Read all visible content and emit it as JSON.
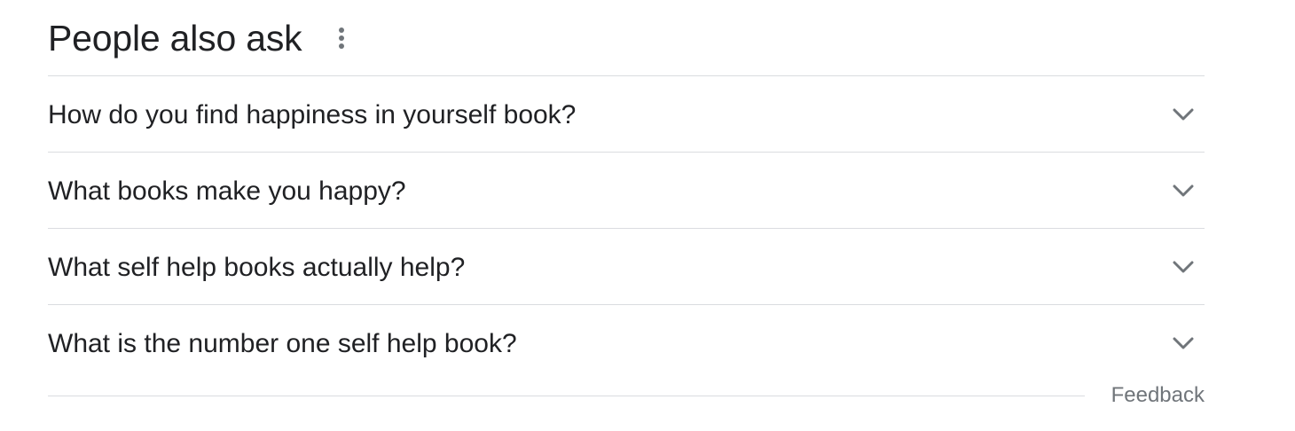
{
  "section": {
    "title": "People also ask",
    "more_icon": "more-vert-icon"
  },
  "questions": [
    {
      "text": "How do you find happiness in yourself book?",
      "icon": "chevron-down-icon"
    },
    {
      "text": "What books make you happy?",
      "icon": "chevron-down-icon"
    },
    {
      "text": "What self help books actually help?",
      "icon": "chevron-down-icon"
    },
    {
      "text": "What is the number one self help book?",
      "icon": "chevron-down-icon"
    }
  ],
  "footer": {
    "feedback_label": "Feedback"
  },
  "colors": {
    "text": "#202124",
    "secondary_text": "#70757a",
    "divider": "#dadce0",
    "icon": "#70757a"
  }
}
